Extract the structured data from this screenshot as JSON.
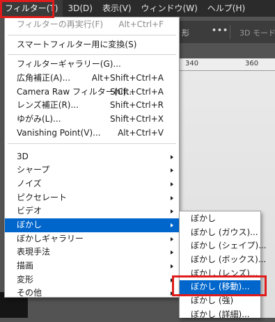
{
  "menubar": {
    "items": [
      {
        "label": "フィルター(T)"
      },
      {
        "label": "3D(D)"
      },
      {
        "label": "表示(V)"
      },
      {
        "label": "ウィンドウ(W)"
      },
      {
        "label": "ヘルプ(H)"
      }
    ]
  },
  "options_bar": {
    "partial_text": "形",
    "dots": "•••",
    "mode_label": "3D モード"
  },
  "ruler": {
    "left_number": "340",
    "right_number": "360"
  },
  "filter_menu": {
    "repeat": {
      "label": "フィルターの再実行(F)",
      "shortcut": "Alt+Ctrl+F"
    },
    "convert": {
      "label": "スマートフィルター用に変換(S)"
    },
    "gallery": {
      "label": "フィルターギャラリー(G)..."
    },
    "wide_angle": {
      "label": "広角補正(A)...",
      "shortcut": "Alt+Shift+Ctrl+A"
    },
    "camera_raw": {
      "label": "Camera Raw フィルター(C)...",
      "shortcut": "Shift+Ctrl+A"
    },
    "lens": {
      "label": "レンズ補正(R)...",
      "shortcut": "Shift+Ctrl+R"
    },
    "liquify": {
      "label": "ゆがみ(L)...",
      "shortcut": "Shift+Ctrl+X"
    },
    "vanishing": {
      "label": "Vanishing Point(V)...",
      "shortcut": "Alt+Ctrl+V"
    },
    "sub": [
      {
        "label": "3D"
      },
      {
        "label": "シャープ"
      },
      {
        "label": "ノイズ"
      },
      {
        "label": "ピクセレート"
      },
      {
        "label": "ビデオ"
      },
      {
        "label": "ぼかし"
      },
      {
        "label": "ぼかしギャラリー"
      },
      {
        "label": "表現手法"
      },
      {
        "label": "描画"
      },
      {
        "label": "変形"
      },
      {
        "label": "その他"
      }
    ]
  },
  "blur_submenu": {
    "items": [
      {
        "label": "ぼかし"
      },
      {
        "label": "ぼかし (ガウス)..."
      },
      {
        "label": "ぼかし (シェイプ)..."
      },
      {
        "label": "ぼかし (ボックス)..."
      },
      {
        "label": "ぼかし (レンズ)..."
      },
      {
        "label": "ぼかし (移動)..."
      },
      {
        "label": "ぼかし (強)"
      },
      {
        "label": "ぼかし (詳細)..."
      }
    ]
  },
  "colors": {
    "highlight": "#0066cc",
    "annotation_red": "#e01b1b",
    "menubar_bg": "#2b2b2b"
  }
}
